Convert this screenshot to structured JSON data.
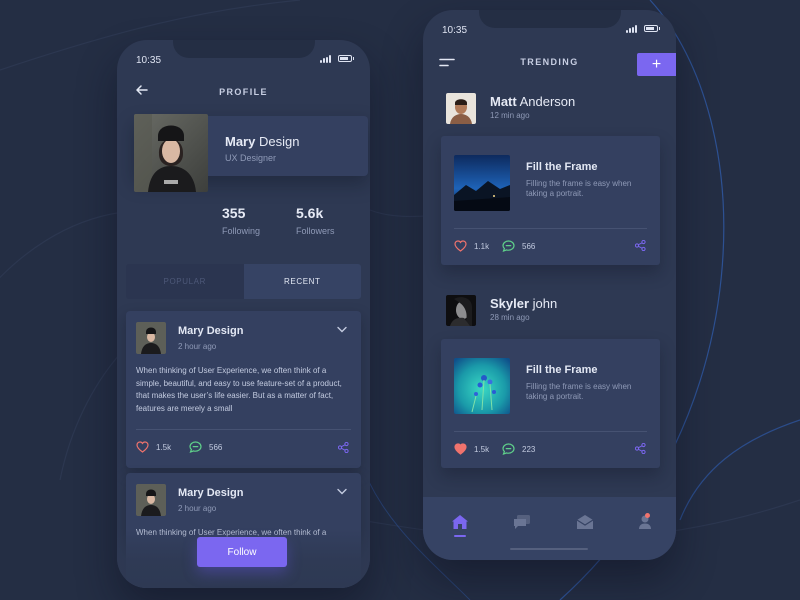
{
  "profile_screen": {
    "status_time": "10:35",
    "title": "PROFILE",
    "user": {
      "first_name": "Mary",
      "last_name": " Design",
      "role": "UX Designer"
    },
    "stats": {
      "following_value": "355",
      "following_label": "Following",
      "followers_value": "5.6k",
      "followers_label": "Followers"
    },
    "tabs": {
      "popular": "POPULAR",
      "recent": "RECENT"
    },
    "posts": [
      {
        "author": "Mary Design",
        "time": "2 hour ago",
        "text": "When thinking of User Experience, we often think of a simple, beautiful, and easy to use feature-set of a product, that makes the user’s life easier. But as a matter of fact, features are merely a small",
        "likes": "1.5k",
        "comments": "566"
      },
      {
        "author": "Mary Design",
        "time": "2 hour ago",
        "text": "When thinking of User Experience, we often think of a"
      }
    ],
    "follow_label": "Follow"
  },
  "trending_screen": {
    "status_time": "10:35",
    "title": "TRENDING",
    "add_label": "+",
    "feed": [
      {
        "user_first": "Matt",
        "user_last": " Anderson",
        "time": "12 min ago",
        "title": "Fill the Frame",
        "desc": "Filling the frame is easy when taking a portrait.",
        "likes": "1.1k",
        "comments": "566",
        "liked": false
      },
      {
        "user_first": "Skyler",
        "user_last": " john",
        "time": "28 min ago",
        "title": "Fill the Frame",
        "desc": "Filling the frame is easy when taking a portrait.",
        "likes": "1.5k",
        "comments": "223",
        "liked": true
      }
    ],
    "nav_items": [
      "home-icon",
      "chat-icon",
      "mail-icon",
      "profile-icon"
    ],
    "active_nav": "home-icon"
  },
  "colors": {
    "background": "#242e44",
    "surface": "#2e3953",
    "card": "#344060",
    "accent": "#7b67f0",
    "like_red": "#f0736d",
    "comment_green": "#5fd08a"
  }
}
